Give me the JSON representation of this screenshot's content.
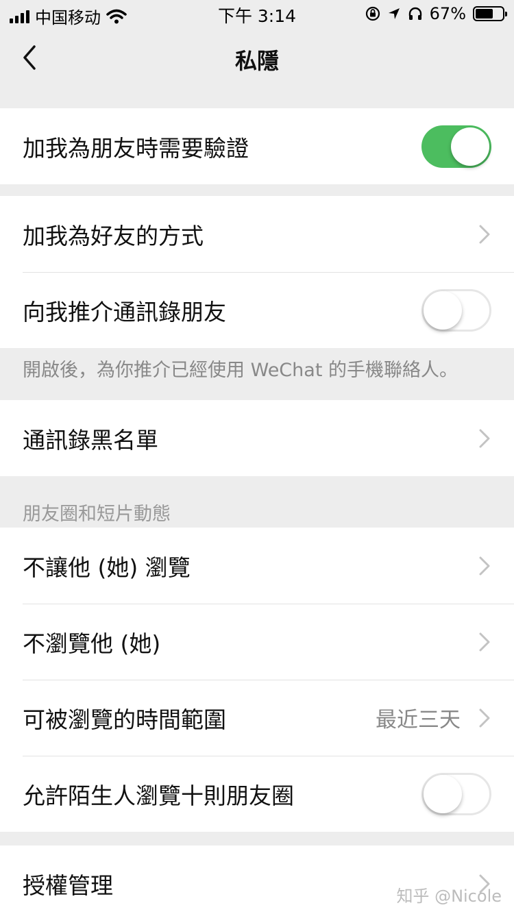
{
  "status_bar": {
    "carrier": "中国移动",
    "time": "下午 3:14",
    "battery_percent": "67%",
    "battery_level": 0.67,
    "icons": [
      "signal-icon",
      "wifi-icon",
      "orientation-lock-icon",
      "location-icon",
      "headphones-icon",
      "battery-icon"
    ]
  },
  "nav": {
    "title": "私隱",
    "back_icon": "chevron-left-icon"
  },
  "sections": {
    "verify": {
      "label": "加我為朋友時需要驗證",
      "toggle": "on"
    },
    "add_methods": {
      "label": "加我為好友的方式"
    },
    "recommend": {
      "label": "向我推介通訊錄朋友",
      "toggle": "off",
      "note": "開啟後，為你推介已經使用 WeChat 的手機聯絡人。"
    },
    "blacklist": {
      "label": "通訊錄黑名單"
    },
    "moments": {
      "header": "朋友圈和短片動態",
      "items": [
        {
          "label": "不讓他 (她) 瀏覽"
        },
        {
          "label": "不瀏覽他 (她)"
        },
        {
          "label": "可被瀏覽的時間範圍",
          "value": "最近三天"
        },
        {
          "label": "允許陌生人瀏覽十則朋友圈",
          "toggle": "off"
        }
      ]
    },
    "auth": {
      "label": "授權管理"
    }
  },
  "watermark": "知乎 @Nicole",
  "colors": {
    "background": "#ededed",
    "toggle_on": "#4cbd5f",
    "secondary_text": "#888888"
  }
}
